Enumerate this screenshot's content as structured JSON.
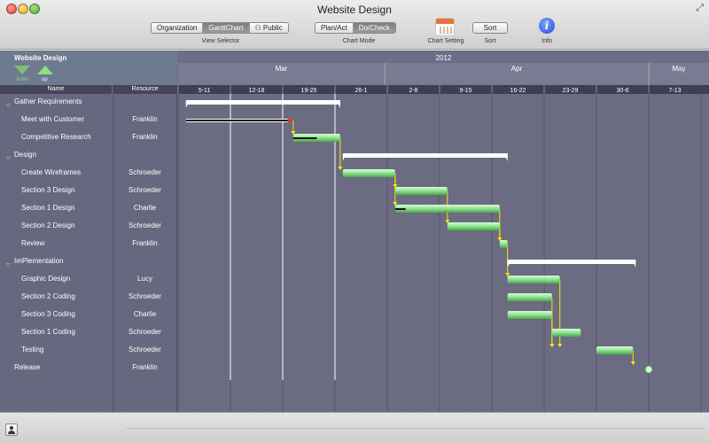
{
  "window": {
    "title": "Website Design"
  },
  "toolbar": {
    "view_selector": {
      "options": [
        "Organization",
        "GanttChart",
        "Public"
      ],
      "selected": "GanttChart",
      "label": "View Selector"
    },
    "chart_mode": {
      "options": [
        "Plan/Act",
        "Do/Check"
      ],
      "selected": "Do/Check",
      "label": "Chart Mode"
    },
    "chart_setting_label": "Chart Setting",
    "sort": {
      "button": "Sort",
      "label": "Sort"
    },
    "info_label": "Info"
  },
  "project": {
    "title": "Website Design",
    "down_label": "down",
    "up_label": "up",
    "columns": {
      "name": "Name",
      "resource": "Resource"
    }
  },
  "rows": [
    {
      "name": "Gather Requirements",
      "resource": "",
      "level": 0,
      "kind": "group"
    },
    {
      "name": "Meet with Customer",
      "resource": "Franklin",
      "level": 1,
      "kind": "task"
    },
    {
      "name": "Competitive Research",
      "resource": "Franklin",
      "level": 1,
      "kind": "task"
    },
    {
      "name": "Design",
      "resource": "",
      "level": 0,
      "kind": "group"
    },
    {
      "name": "Create Wireframes",
      "resource": "Schroeder",
      "level": 1,
      "kind": "task"
    },
    {
      "name": "Section 3 Design",
      "resource": "Schroeder",
      "level": 1,
      "kind": "task"
    },
    {
      "name": "Section 1 Design",
      "resource": "Charlie",
      "level": 1,
      "kind": "task"
    },
    {
      "name": "Section 2 Design",
      "resource": "Schroeder",
      "level": 1,
      "kind": "task"
    },
    {
      "name": "Review",
      "resource": "Franklin",
      "level": 1,
      "kind": "task"
    },
    {
      "name": "ImPlementation",
      "resource": "",
      "level": 0,
      "kind": "group"
    },
    {
      "name": "Graphic Design",
      "resource": "Lucy",
      "level": 1,
      "kind": "task"
    },
    {
      "name": "Section 2 Coding",
      "resource": "Schroeder",
      "level": 1,
      "kind": "task"
    },
    {
      "name": "Section 3 Coding",
      "resource": "Charlie",
      "level": 1,
      "kind": "task"
    },
    {
      "name": "Section 1 Coding",
      "resource": "Schroeder",
      "level": 1,
      "kind": "task"
    },
    {
      "name": "Testing",
      "resource": "Schroeder",
      "level": 1,
      "kind": "task"
    },
    {
      "name": "Release",
      "resource": "Franklin",
      "level": 0,
      "kind": "milestone"
    }
  ],
  "timeline": {
    "year": "2012",
    "months": [
      "Mar",
      "Apr",
      "May"
    ],
    "weeks": [
      "5-11",
      "12-18",
      "19-25",
      "26-1",
      "2-8",
      "9-15",
      "16-22",
      "23-29",
      "30-6",
      "7-13"
    ]
  },
  "gantt": {
    "groups": [
      {
        "row": 0,
        "start": 0.15,
        "end": 3.1
      },
      {
        "row": 3,
        "start": 3.15,
        "end": 6.3
      },
      {
        "row": 9,
        "start": 6.3,
        "end": 8.75
      }
    ],
    "tasks": [
      {
        "row": 1,
        "start": 0.15,
        "end": 2.2,
        "progress": 1.0,
        "style": "late"
      },
      {
        "row": 2,
        "start": 2.2,
        "end": 3.1,
        "progress": 0.5,
        "style": "normal"
      },
      {
        "row": 4,
        "start": 3.15,
        "end": 4.15,
        "progress": 0,
        "style": "normal"
      },
      {
        "row": 5,
        "start": 4.15,
        "end": 5.15,
        "progress": 0,
        "style": "normal"
      },
      {
        "row": 6,
        "start": 4.15,
        "end": 6.15,
        "progress": 0.1,
        "style": "normal"
      },
      {
        "row": 7,
        "start": 5.15,
        "end": 6.15,
        "progress": 0,
        "style": "normal"
      },
      {
        "row": 8,
        "start": 6.15,
        "end": 6.3,
        "progress": 0,
        "style": "normal"
      },
      {
        "row": 10,
        "start": 6.3,
        "end": 7.3,
        "progress": 0,
        "style": "normal"
      },
      {
        "row": 11,
        "start": 6.3,
        "end": 7.15,
        "progress": 0,
        "style": "normal"
      },
      {
        "row": 12,
        "start": 6.3,
        "end": 7.15,
        "progress": 0,
        "style": "normal"
      },
      {
        "row": 13,
        "start": 7.15,
        "end": 7.7,
        "progress": 0,
        "style": "normal"
      },
      {
        "row": 14,
        "start": 8.0,
        "end": 8.7,
        "progress": 0,
        "style": "normal"
      }
    ],
    "milestones": [
      {
        "row": 15,
        "at": 9.0
      }
    ],
    "dependencies": [
      {
        "from": 2,
        "to": 4
      },
      {
        "from": 4,
        "to": 5
      },
      {
        "from": 4,
        "to": 6
      },
      {
        "from": 5,
        "to": 7
      },
      {
        "from": 7,
        "to": 8
      },
      {
        "from": 6,
        "to": 8
      },
      {
        "from": 8,
        "to": 10
      },
      {
        "from": 10,
        "to": 14
      },
      {
        "from": 11,
        "to": 14
      },
      {
        "from": 12,
        "to": 14
      },
      {
        "from": 14,
        "to": 15
      },
      {
        "from": 1,
        "to": 2
      }
    ],
    "colors": {
      "bar": "#8fe08f",
      "bar_dark": "#4aa84a",
      "group": "#ffffff",
      "dependency": "#ffe600",
      "late": "#e53030",
      "grid": "#55556e",
      "today": "#ffffff"
    }
  }
}
